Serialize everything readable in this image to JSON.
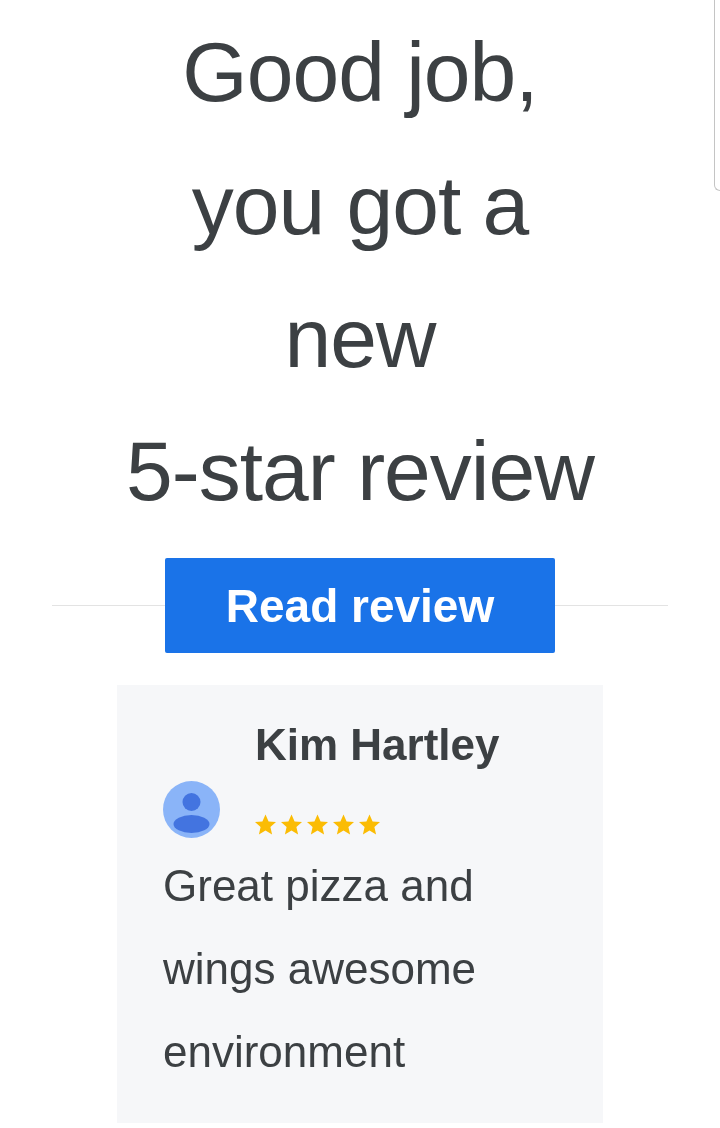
{
  "headline": "Good job,\nyou got a\nnew\n5-star review",
  "button": {
    "label": "Read review"
  },
  "review": {
    "author": "Kim Hartley",
    "stars": 5,
    "text": "Great pizza and wings awesome environment"
  }
}
